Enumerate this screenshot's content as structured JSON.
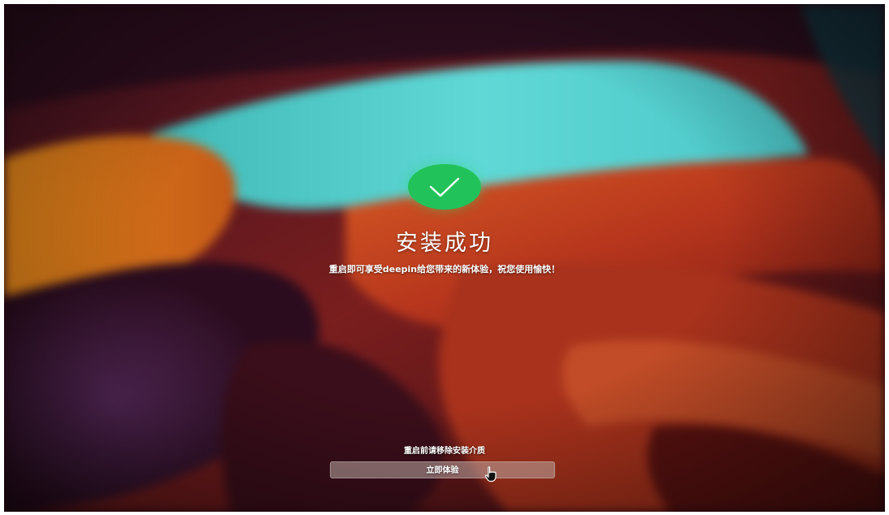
{
  "installer": {
    "status_icon": "checkmark-icon",
    "title": "安装成功",
    "subtitle": "重启即可享受deepin给您带来的新体验，祝您使用愉快！",
    "hint": "重启前请移除安装介质",
    "primary_button_label": "立即体验",
    "cursor_icon": "hand-pointer-icon"
  },
  "colors": {
    "success_green": "#22c25a",
    "text": "#ffffff"
  }
}
